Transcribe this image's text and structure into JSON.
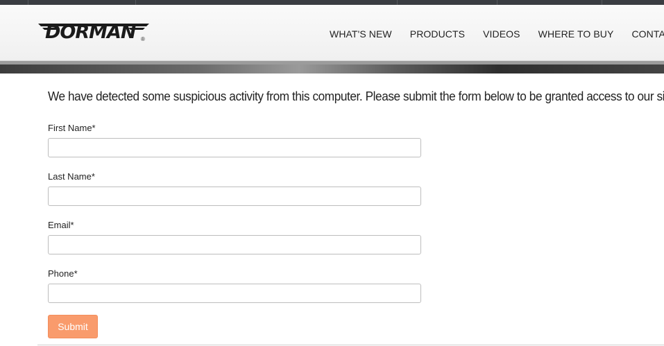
{
  "logo": {
    "text": "DORMAN",
    "reg_mark": "®"
  },
  "nav": {
    "items": [
      "WHAT'S NEW",
      "PRODUCTS",
      "VIDEOS",
      "WHERE TO BUY",
      "CONTACT"
    ]
  },
  "message": "We have detected some suspicious activity from this computer. Please submit the form below to be granted access to our site.",
  "form": {
    "fields": [
      {
        "label": "First Name*",
        "value": "",
        "placeholder": ""
      },
      {
        "label": "Last Name*",
        "value": "",
        "placeholder": ""
      },
      {
        "label": "Email*",
        "value": "",
        "placeholder": ""
      },
      {
        "label": "Phone*",
        "value": "",
        "placeholder": ""
      }
    ],
    "submit_label": "Submit"
  },
  "colors": {
    "topbar": "#3a3d42",
    "submit_bg": "#f99b6c",
    "text": "#222222"
  }
}
